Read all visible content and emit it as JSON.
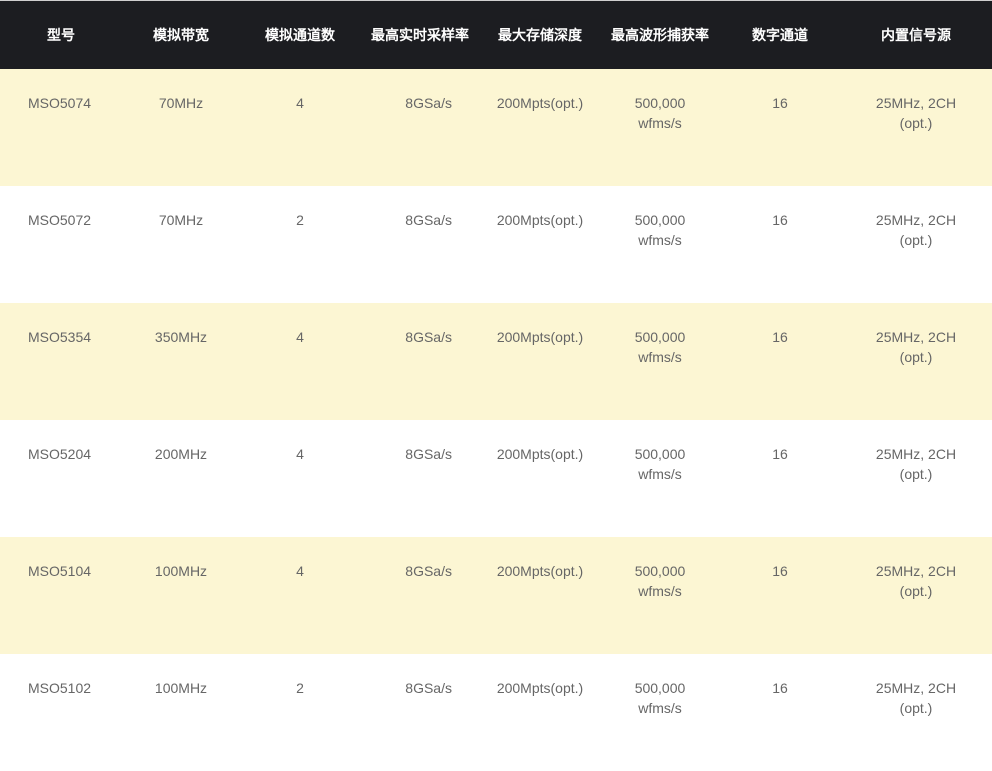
{
  "headers": [
    "型号",
    "模拟带宽",
    "模拟通道数",
    "最高实时采样率",
    "最大存储深度",
    "最高波形捕获率",
    "数字通道",
    "内置信号源"
  ],
  "rows": [
    [
      "MSO5074",
      "70MHz",
      "4",
      "8GSa/s",
      "200Mpts(opt.)",
      "500,000\nwfms/s",
      "16",
      "25MHz, 2CH\n(opt.)"
    ],
    [
      "MSO5072",
      "70MHz",
      "2",
      "8GSa/s",
      "200Mpts(opt.)",
      "500,000\nwfms/s",
      "16",
      "25MHz, 2CH\n(opt.)"
    ],
    [
      "MSO5354",
      "350MHz",
      "4",
      "8GSa/s",
      "200Mpts(opt.)",
      "500,000\nwfms/s",
      "16",
      "25MHz, 2CH\n(opt.)"
    ],
    [
      "MSO5204",
      "200MHz",
      "4",
      "8GSa/s",
      "200Mpts(opt.)",
      "500,000\nwfms/s",
      "16",
      "25MHz, 2CH\n(opt.)"
    ],
    [
      "MSO5104",
      "100MHz",
      "4",
      "8GSa/s",
      "200Mpts(opt.)",
      "500,000\nwfms/s",
      "16",
      "25MHz, 2CH\n(opt.)"
    ],
    [
      "MSO5102",
      "100MHz",
      "2",
      "8GSa/s",
      "200Mpts(opt.)",
      "500,000\nwfms/s",
      "16",
      "25MHz, 2CH\n(opt.)"
    ]
  ],
  "colors": {
    "header_bg": "#1c1d21",
    "header_text": "#ffffff",
    "row_highlight": "#fcf6d3",
    "row_plain": "#ffffff",
    "cell_text": "#666666"
  }
}
